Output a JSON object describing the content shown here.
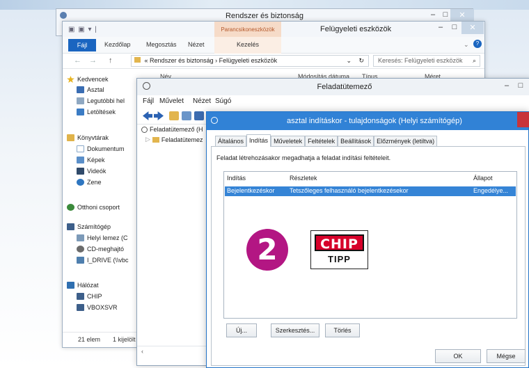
{
  "back_window": {
    "title": "Rendszer és biztonság",
    "minimize": "–",
    "maximize": "□",
    "close": "✕"
  },
  "explorer": {
    "title": "Felügyeleti eszközök",
    "context_tab": "Parancsikoneszközök",
    "minimize": "–",
    "maximize": "□",
    "close": "✕",
    "ribbon_tabs": [
      "Fájl",
      "Kezdőlap",
      "Megosztás",
      "Nézet",
      "Kezelés"
    ],
    "help_icon": "?",
    "back": "←",
    "forward": "→",
    "up": "↑",
    "address_parts": [
      "«",
      "Rendszer és biztonság",
      "›",
      "Felügyeleti eszközök"
    ],
    "dropdown": "⌄",
    "refresh": "↻",
    "search_placeholder": "Keresés: Felügyeleti eszközök",
    "search_icon": "⌕",
    "columns": [
      "Név",
      "Módosítás dátuma",
      "Típus",
      "Méret"
    ],
    "nav_items": [
      {
        "label": "Kedvencek",
        "icon": "star-icon",
        "color": "#e8b422"
      },
      {
        "label": "Asztal",
        "icon": "desktop-icon",
        "color": "#3a6db3"
      },
      {
        "label": "Legutóbbi hel",
        "icon": "recent-icon",
        "color": "#8fa8c2"
      },
      {
        "label": "Letöltések",
        "icon": "downloads-icon",
        "color": "#3b7cc4"
      },
      {
        "label": "Könyvtárak",
        "icon": "library-icon",
        "color": "#e0b34a"
      },
      {
        "label": "Dokumentum",
        "icon": "document-icon",
        "color": "#8aa9c9"
      },
      {
        "label": "Képek",
        "icon": "pictures-icon",
        "color": "#5a8fc9"
      },
      {
        "label": "Videók",
        "icon": "videos-icon",
        "color": "#304a6a"
      },
      {
        "label": "Zene",
        "icon": "music-icon",
        "color": "#2e76c0"
      },
      {
        "label": "Otthoni csoport",
        "icon": "homegroup-icon",
        "color": "#3b8a3b"
      },
      {
        "label": "Számítógép",
        "icon": "computer-icon",
        "color": "#3d5f8a"
      },
      {
        "label": "Helyi lemez (C",
        "icon": "drive-icon",
        "color": "#7c9ab8"
      },
      {
        "label": "CD-meghajtó",
        "icon": "cd-drive-icon",
        "color": "#6b6b6b"
      },
      {
        "label": "I_DRIVE (\\\\vbc",
        "icon": "network-drive-icon",
        "color": "#4f7fae"
      },
      {
        "label": "Hálózat",
        "icon": "network-icon",
        "color": "#2f6fb0"
      },
      {
        "label": "CHIP",
        "icon": "computer-icon",
        "color": "#3d5f8a"
      },
      {
        "label": "VBOXSVR",
        "icon": "computer-icon",
        "color": "#3d5f8a"
      }
    ],
    "status_count": "21 elem",
    "status_selected": "1 kijelölt"
  },
  "scheduler": {
    "title": "Feladatütemező",
    "minimize": "–",
    "maximize": "□",
    "menu": [
      "Fájl",
      "Művelet",
      "Nézet",
      "Súgó"
    ],
    "tree": [
      "Feladatütemező (H",
      "Feladatütemez"
    ],
    "scroll_left": "‹"
  },
  "dialog": {
    "title": "asztal indításkor - tulajdonságok (Helyi számítógép)",
    "tabs": [
      "Általános",
      "Indítás",
      "Műveletek",
      "Feltételek",
      "Beállítások",
      "Előzmények (letiltva)"
    ],
    "active_tab": "Indítás",
    "description": "Feladat létrehozásakor megadhatja a feladat indítási feltételeit.",
    "columns": [
      "Indítás",
      "Részletek",
      "Állapot"
    ],
    "rows": [
      {
        "trigger": "Bejelentkezéskor",
        "details": "Tetszőleges felhasználó bejelentkezésekor",
        "status": "Engedélye..."
      }
    ],
    "buttons": {
      "new": "Új...",
      "edit": "Szerkesztés...",
      "delete": "Törlés",
      "ok": "OK",
      "cancel": "Mégse"
    }
  },
  "overlay": {
    "step_number": "2",
    "logo_text": "CHIP",
    "logo_sub": "TIPP",
    "badge_color": "#b31683",
    "logo_color": "#d7002a"
  }
}
